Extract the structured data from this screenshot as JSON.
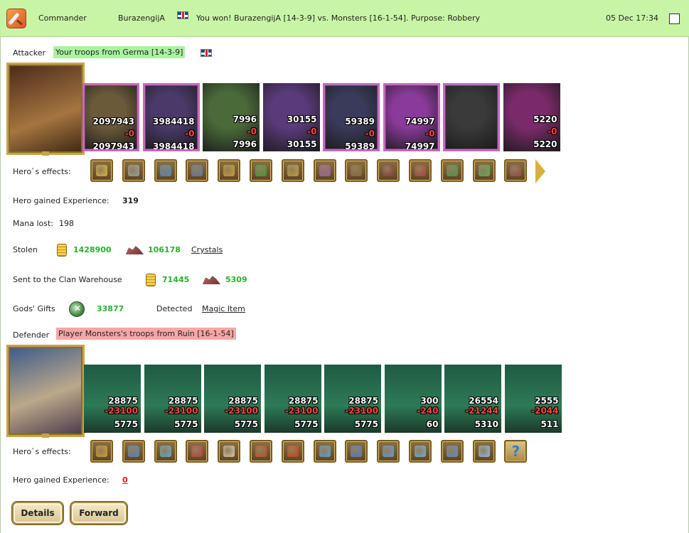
{
  "header": {
    "category": "Commander",
    "player": "BurazengijA",
    "message": "You won! BurazengijA [14-3-9] vs. Monsters [16-1-54]. Purpose: Robbery",
    "datetime": "05 Dec 17:34",
    "icon": "sword-icon"
  },
  "attacker": {
    "label": "Attacker",
    "troops": "Your troops from Germa [14-3-9]",
    "flag": "uk-flag-icon",
    "units": [
      {
        "count": "2097943",
        "loss": "-0",
        "remaining": "2097943",
        "frame": "pink",
        "color": "#6b5a3a"
      },
      {
        "count": "3984418",
        "loss": "-0",
        "remaining": "3984418",
        "frame": "pink",
        "color": "#4a3a6a"
      },
      {
        "count": "7996",
        "loss": "-0",
        "remaining": "7996",
        "frame": "none",
        "color": "#4a6a3a"
      },
      {
        "count": "30155",
        "loss": "-0",
        "remaining": "30155",
        "frame": "none",
        "color": "#5a3a7a"
      },
      {
        "count": "59389",
        "loss": "-0",
        "remaining": "59389",
        "frame": "pink",
        "color": "#3a3a5a"
      },
      {
        "count": "74997",
        "loss": "-0",
        "remaining": "74997",
        "frame": "pink",
        "color": "#8a3a9a"
      },
      {
        "count": "",
        "loss": "",
        "remaining": "",
        "frame": "pink",
        "color": "#3a3a3a"
      },
      {
        "count": "5220",
        "loss": "-0",
        "remaining": "5220",
        "frame": "none",
        "color": "#7a2a6a"
      }
    ],
    "effects_label": "Hero`s effects:",
    "effects": [
      "helmet-icon",
      "armor-icon",
      "gauntlet-icon",
      "breastplate-icon",
      "amulet-icon",
      "clover-icon",
      "trident-icon",
      "wing-icon",
      "club-icon",
      "cloak-icon",
      "heart-shield-icon",
      "horseshoe-heart-icon",
      "sword-icon",
      "twin-daggers-icon"
    ],
    "experience_label": "Hero gained Experience:",
    "experience": "319",
    "mana_label": "Mana lost:",
    "mana": "198",
    "stolen_label": "Stolen",
    "stolen_gold": "1428900",
    "stolen_crystals": "106178",
    "stolen_link": "Crystals",
    "clan_label": "Sent to the Clan Warehouse",
    "clan_gold": "71445",
    "clan_crystals": "5309",
    "gifts_label": "Gods' Gifts",
    "gifts_value": "33877",
    "detected_label": "Detected",
    "detected_link": "Magic Item"
  },
  "defender": {
    "label": "Defender",
    "troops": "Player Monsters's troops from Ruin [16-1-54]",
    "units": [
      {
        "count": "28875",
        "loss": "-23100",
        "remaining": "5775",
        "color": "#2a4a3a"
      },
      {
        "count": "28875",
        "loss": "-23100",
        "remaining": "5775",
        "color": "#3a3a3a"
      },
      {
        "count": "28875",
        "loss": "-23100",
        "remaining": "5775",
        "color": "#3a5a3a"
      },
      {
        "count": "28875",
        "loss": "-23100",
        "remaining": "5775",
        "color": "#5a2a2a"
      },
      {
        "count": "28875",
        "loss": "-23100",
        "remaining": "5775",
        "color": "#5a3a2a"
      },
      {
        "count": "300",
        "loss": "-240",
        "remaining": "60",
        "color": "#6a2a2a"
      },
      {
        "count": "26554",
        "loss": "-21244",
        "remaining": "5310",
        "color": "#4a4a4a"
      },
      {
        "count": "2555",
        "loss": "-2044",
        "remaining": "511",
        "color": "#4a2a5a"
      }
    ],
    "effects_label": "Hero`s effects:",
    "effects": [
      "helmet-icon",
      "arrows-icon",
      "shield-icon",
      "demon-mask-icon",
      "skeleton-icon",
      "crossed-axes-icon",
      "fire-head-icon",
      "ice-mage-icon",
      "ice-armor-icon",
      "ice-ring-icon",
      "ice-axe-icon",
      "ice-staff-icon",
      "ice-crystal-icon",
      "question-icon"
    ],
    "experience_label": "Hero gained Experience:",
    "experience": "0"
  },
  "buttons": {
    "details": "Details",
    "forward": "Forward"
  }
}
